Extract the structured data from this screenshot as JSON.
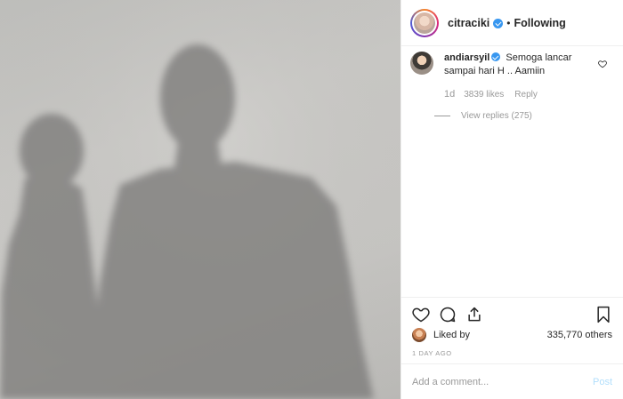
{
  "header": {
    "username": "citraciki",
    "separator": "•",
    "follow_status": "Following"
  },
  "comment": {
    "username": "andiarsyil",
    "text": "Semoga lancar sampai hari H .. Aamiin",
    "age": "1d",
    "likes": "3839 likes",
    "reply_label": "Reply",
    "view_replies": "View replies (275)"
  },
  "liked": {
    "label": "Liked by",
    "count": "335,770 others"
  },
  "timestamp": "1 DAY AGO",
  "add_comment": {
    "placeholder": "Add a comment...",
    "post_label": "Post"
  },
  "colors": {
    "verified": "#3897f0",
    "post_disabled": "#b2dffc",
    "meta_gray": "#999999"
  },
  "icons": [
    "heart-icon",
    "comment-icon",
    "share-icon",
    "bookmark-icon",
    "verified-badge-icon"
  ]
}
